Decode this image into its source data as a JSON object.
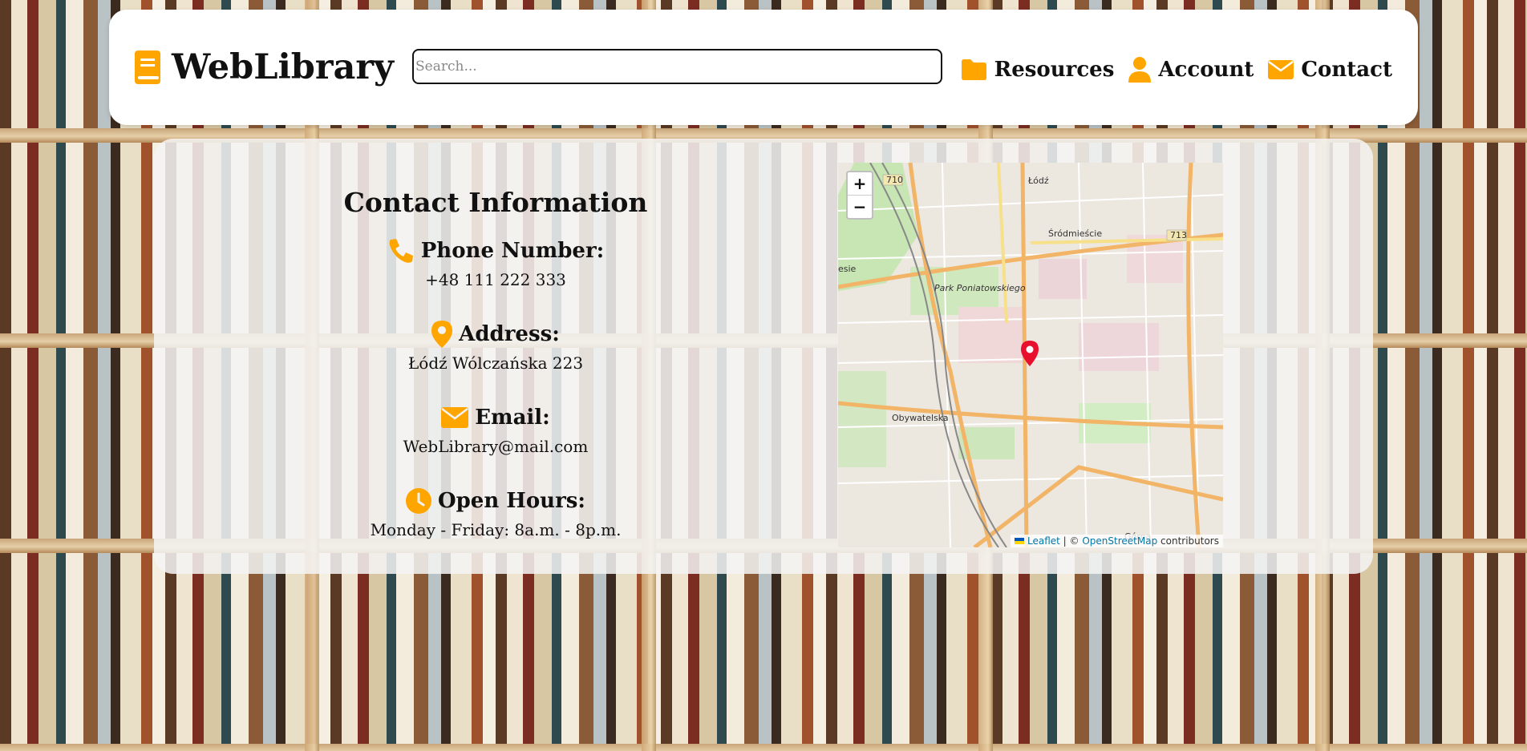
{
  "header": {
    "brand": "WebLibrary",
    "search_placeholder": "Search...",
    "nav": [
      {
        "label": "Resources",
        "icon": "folder-icon"
      },
      {
        "label": "Account",
        "icon": "user-icon"
      },
      {
        "label": "Contact",
        "icon": "envelope-icon"
      }
    ]
  },
  "contact": {
    "title": "Contact Information",
    "phone_label": "Phone Number:",
    "phone_value": "+48 111 222 333",
    "address_label": "Address:",
    "address_value": "Łódź Wólczańska 223",
    "email_label": "Email:",
    "email_value": "WebLibrary@mail.com",
    "hours_label": "Open Hours:",
    "hours_value": "Monday - Friday: 8a.m. - 8p.m."
  },
  "map": {
    "zoom_in": "+",
    "zoom_out": "−",
    "attrib_leaflet": "Leaflet",
    "attrib_sep": " | © ",
    "attrib_osm": "OpenStreetMap",
    "attrib_suffix": " contributors",
    "labels": {
      "city": "Łódź",
      "district1": "Śródmieście",
      "district2": "Górna",
      "park": "Park Poniatowskiego",
      "road1": "710",
      "road2": "713",
      "street": "Obywatelska",
      "edge": "esie"
    }
  },
  "colors": {
    "accent": "#ffa500",
    "marker": "#e8112d"
  }
}
